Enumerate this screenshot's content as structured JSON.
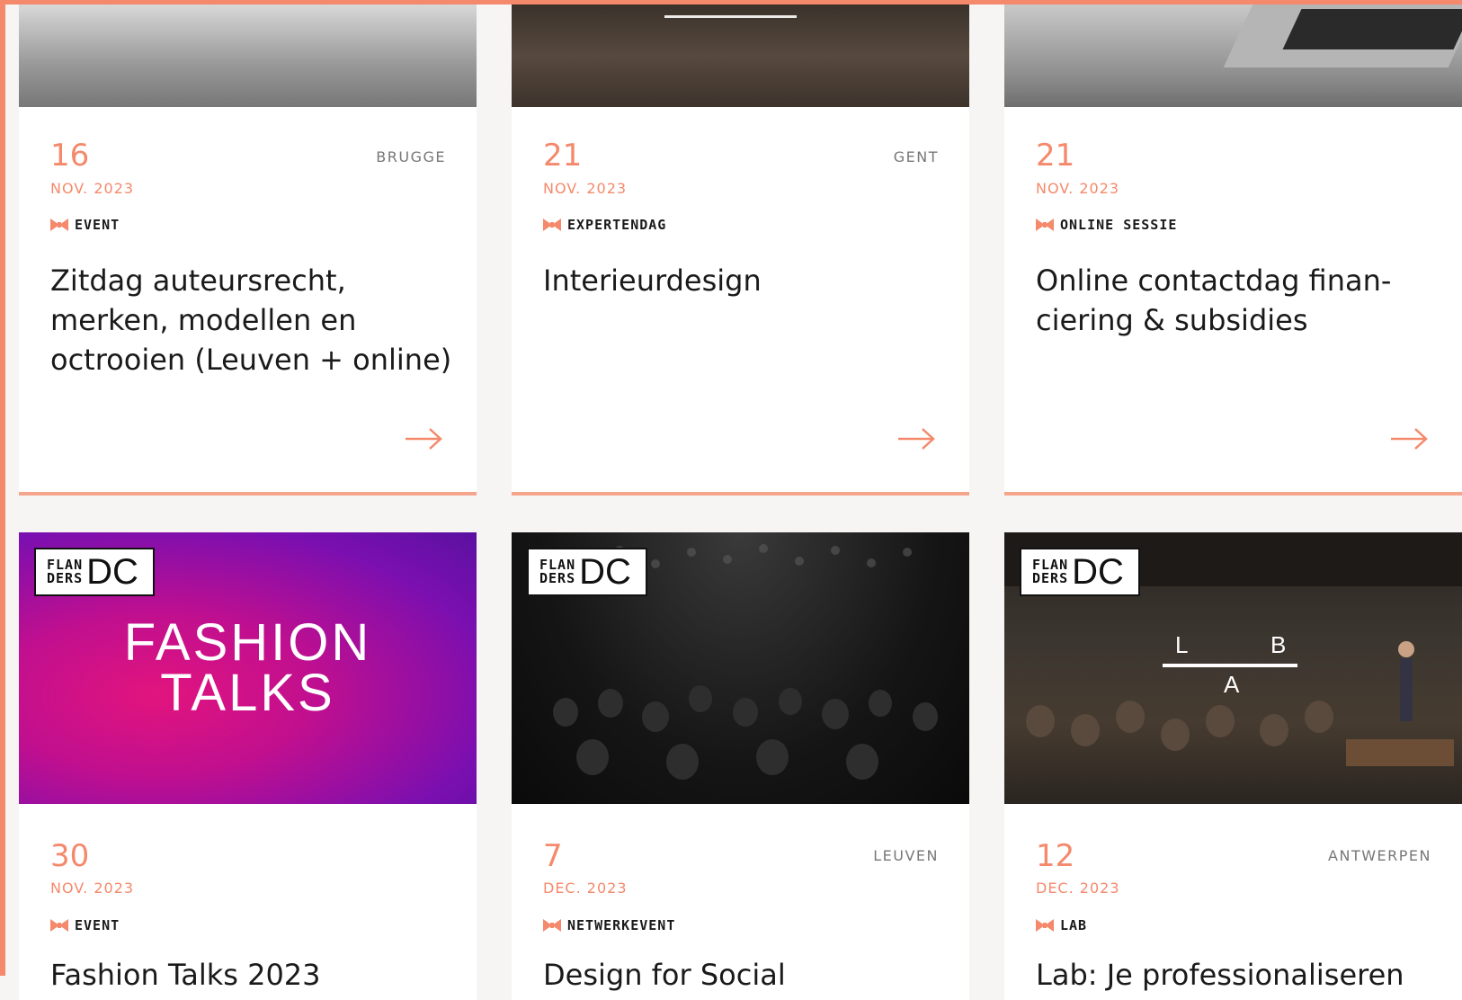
{
  "colors": {
    "accent": "#f4896b",
    "text": "#1a1a1a",
    "muted": "#777777"
  },
  "cards": [
    {
      "day": "16",
      "month": "NOV. 2023",
      "city": "BRUGGE",
      "type": "EVENT",
      "title": "Zitdag auteursrecht, merken, modellen en octrooien (Leuven + online)",
      "arrow_icon": "arrow-right-icon"
    },
    {
      "day": "21",
      "month": "NOV. 2023",
      "city": "GENT",
      "type": "EXPERTENDAG",
      "title": "Interieurdesign",
      "arrow_icon": "arrow-right-icon"
    },
    {
      "day": "21",
      "month": "NOV. 2023",
      "city": "",
      "type": "ONLINE SESSIE",
      "title": "Online contactdag finan-ciering & subsidies",
      "arrow_icon": "arrow-right-icon"
    },
    {
      "day": "30",
      "month": "NOV. 2023",
      "city": "",
      "type": "EVENT",
      "title": "Fashion Talks 2023",
      "image_text": [
        "FASHION",
        "TALKS"
      ]
    },
    {
      "day": "7",
      "month": "DEC. 2023",
      "city": "LEUVEN",
      "type": "NETWERKEVENT",
      "title": "Design for Social"
    },
    {
      "day": "12",
      "month": "DEC. 2023",
      "city": "ANTWERPEN",
      "type": "LAB",
      "title": "Lab: Je professionaliseren",
      "image_text": [
        "L",
        "B",
        "A"
      ]
    }
  ],
  "logo": {
    "small_top": "FLAN",
    "small_bottom": "DERS",
    "big": "DC"
  }
}
